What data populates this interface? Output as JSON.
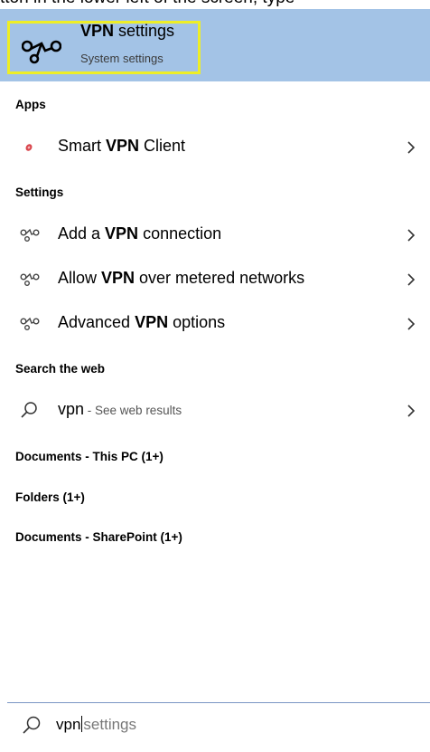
{
  "top_fragment": "tton in the lower left of the screen, type",
  "best_match": {
    "title_bold": "VPN",
    "title_rest": " settings",
    "subtitle": "System settings",
    "icon": "vpn-icon",
    "highlight_color": "#eeee26"
  },
  "sections": {
    "apps": "Apps",
    "settings": "Settings",
    "search_web": "Search the web",
    "documents_pc": "Documents - This PC (1+)",
    "folders": "Folders (1+)",
    "documents_sp": "Documents - SharePoint (1+)"
  },
  "apps": [
    {
      "pre": "Smart ",
      "bold": "VPN",
      "post": " Client",
      "icon": "smart-vpn-client-icon"
    }
  ],
  "settings": [
    {
      "pre": "Add a ",
      "bold": "VPN",
      "post": " connection",
      "icon": "vpn-icon"
    },
    {
      "pre": "Allow ",
      "bold": "VPN",
      "post": " over metered networks",
      "icon": "vpn-icon"
    },
    {
      "pre": "Advanced ",
      "bold": "VPN",
      "post": " options",
      "icon": "vpn-icon"
    }
  ],
  "web": {
    "query": "vpn",
    "suffix": " - See web results",
    "icon": "search-icon"
  },
  "search_box": {
    "typed": "vpn",
    "suggestion": "settings",
    "icon": "search-icon"
  },
  "colors": {
    "best_match_bg": "#a3c3e6",
    "search_border": "#7a96c4",
    "app_icon_red": "#d9454c"
  }
}
